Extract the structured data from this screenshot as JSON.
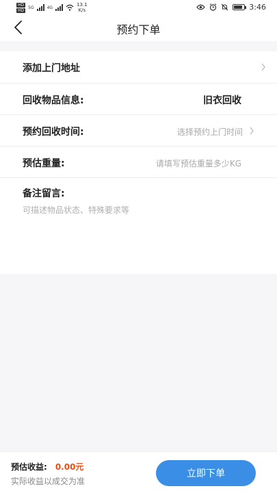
{
  "status": {
    "speed": "13.1",
    "speed_unit": "K/s",
    "net_a": "5G",
    "net_b": "4G",
    "hd": "HD",
    "time": "3:46",
    "icons": [
      "eye-icon",
      "alarm-icon",
      "mute-icon",
      "battery-icon"
    ]
  },
  "nav": {
    "title": "预约下单",
    "back_icon": "chevron-left-icon"
  },
  "form": {
    "address": {
      "label": "添加上门地址"
    },
    "item": {
      "label": "回收物品信息:",
      "value": "旧衣回收"
    },
    "time": {
      "label": "预约回收时间:",
      "placeholder": "选择预约上门时间"
    },
    "weight": {
      "label": "预估重量:",
      "placeholder": "请填写预估重量多少KG"
    },
    "remark": {
      "label": "备注留言:",
      "placeholder": "可描述物品状态、特殊要求等"
    }
  },
  "footer": {
    "earnings_label": "预估收益:",
    "earnings_value": "0.00元",
    "earnings_note": "实际收益以成交为准",
    "submit_label": "立即下单"
  },
  "colors": {
    "accent": "#3a8ee6",
    "amount": "#ef4d12"
  }
}
